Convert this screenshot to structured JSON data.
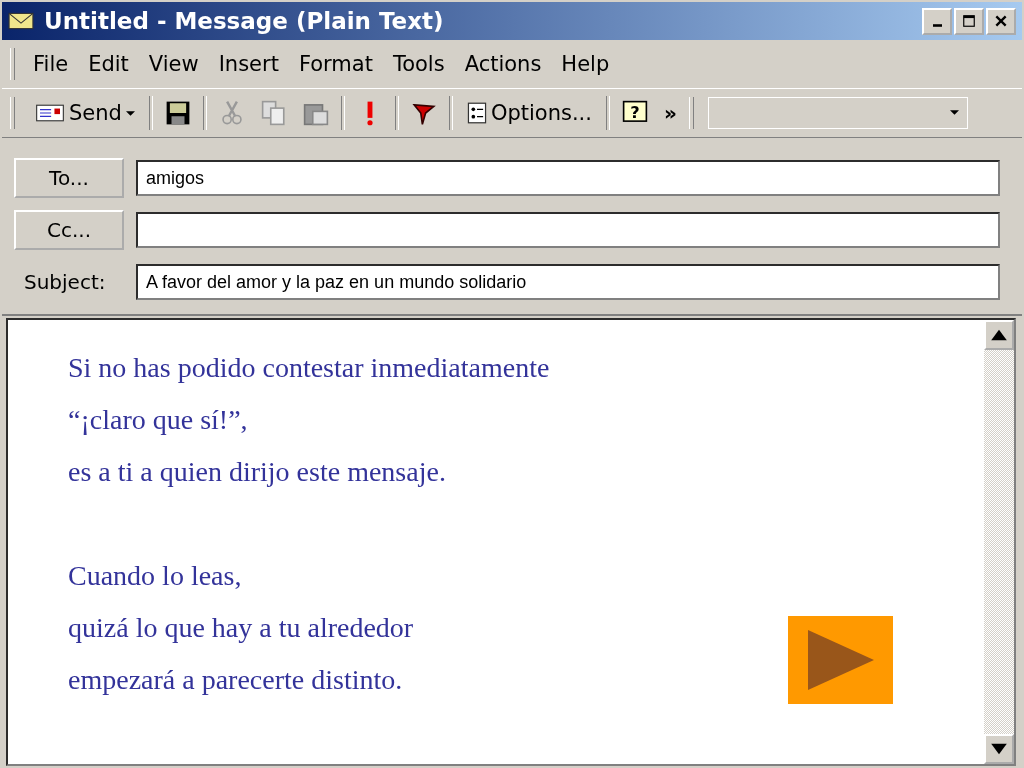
{
  "window": {
    "title": "Untitled - Message (Plain Text)"
  },
  "menu": [
    "File",
    "Edit",
    "View",
    "Insert",
    "Format",
    "Tools",
    "Actions",
    "Help"
  ],
  "toolbar": {
    "send": "Send",
    "options": "Options...",
    "overflow": "»",
    "help": "?"
  },
  "fields": [
    {
      "kind": "button",
      "label": "To...",
      "value": "amigos"
    },
    {
      "kind": "button",
      "label": "Cc..."
    },
    {
      "kind": "label",
      "label": "Subject:",
      "value": "A favor del amor y la paz en un mundo solidario"
    }
  ],
  "body": {
    "paragraphs": [
      [
        "Si no has podido contestar inmediatamente",
        "“¡claro que sí!”,",
        "es a ti a quien dirijo este mensaje."
      ],
      [
        "Cuando lo leas,",
        "quizá lo que hay a tu alrededor",
        "empezará a parecerte distinto."
      ]
    ]
  }
}
